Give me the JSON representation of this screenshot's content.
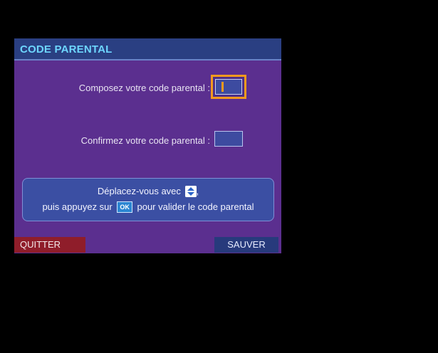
{
  "dialog": {
    "title": "CODE PARENTAL",
    "compose_label": "Composez votre code parental :",
    "confirm_label": "Confirmez votre code parental :",
    "help_line1": "Déplacez-vous avec",
    "help_line2_prefix": "puis appuyez sur",
    "ok_key": "OK",
    "help_line2_suffix": "pour valider le code parental",
    "quit_button": "QUITTER",
    "save_button": "SAUVER"
  },
  "colors": {
    "background": "#000000",
    "dialog": "#5b2f8f",
    "title_bar": "#2a3f82",
    "title_text": "#6dd6ff",
    "focus_outline": "#f39a1e",
    "quit": "#8f1d2a",
    "save": "#273a7c"
  },
  "icons": {
    "nav": "up-down-arrow-icon",
    "ok": "ok-key-icon"
  }
}
